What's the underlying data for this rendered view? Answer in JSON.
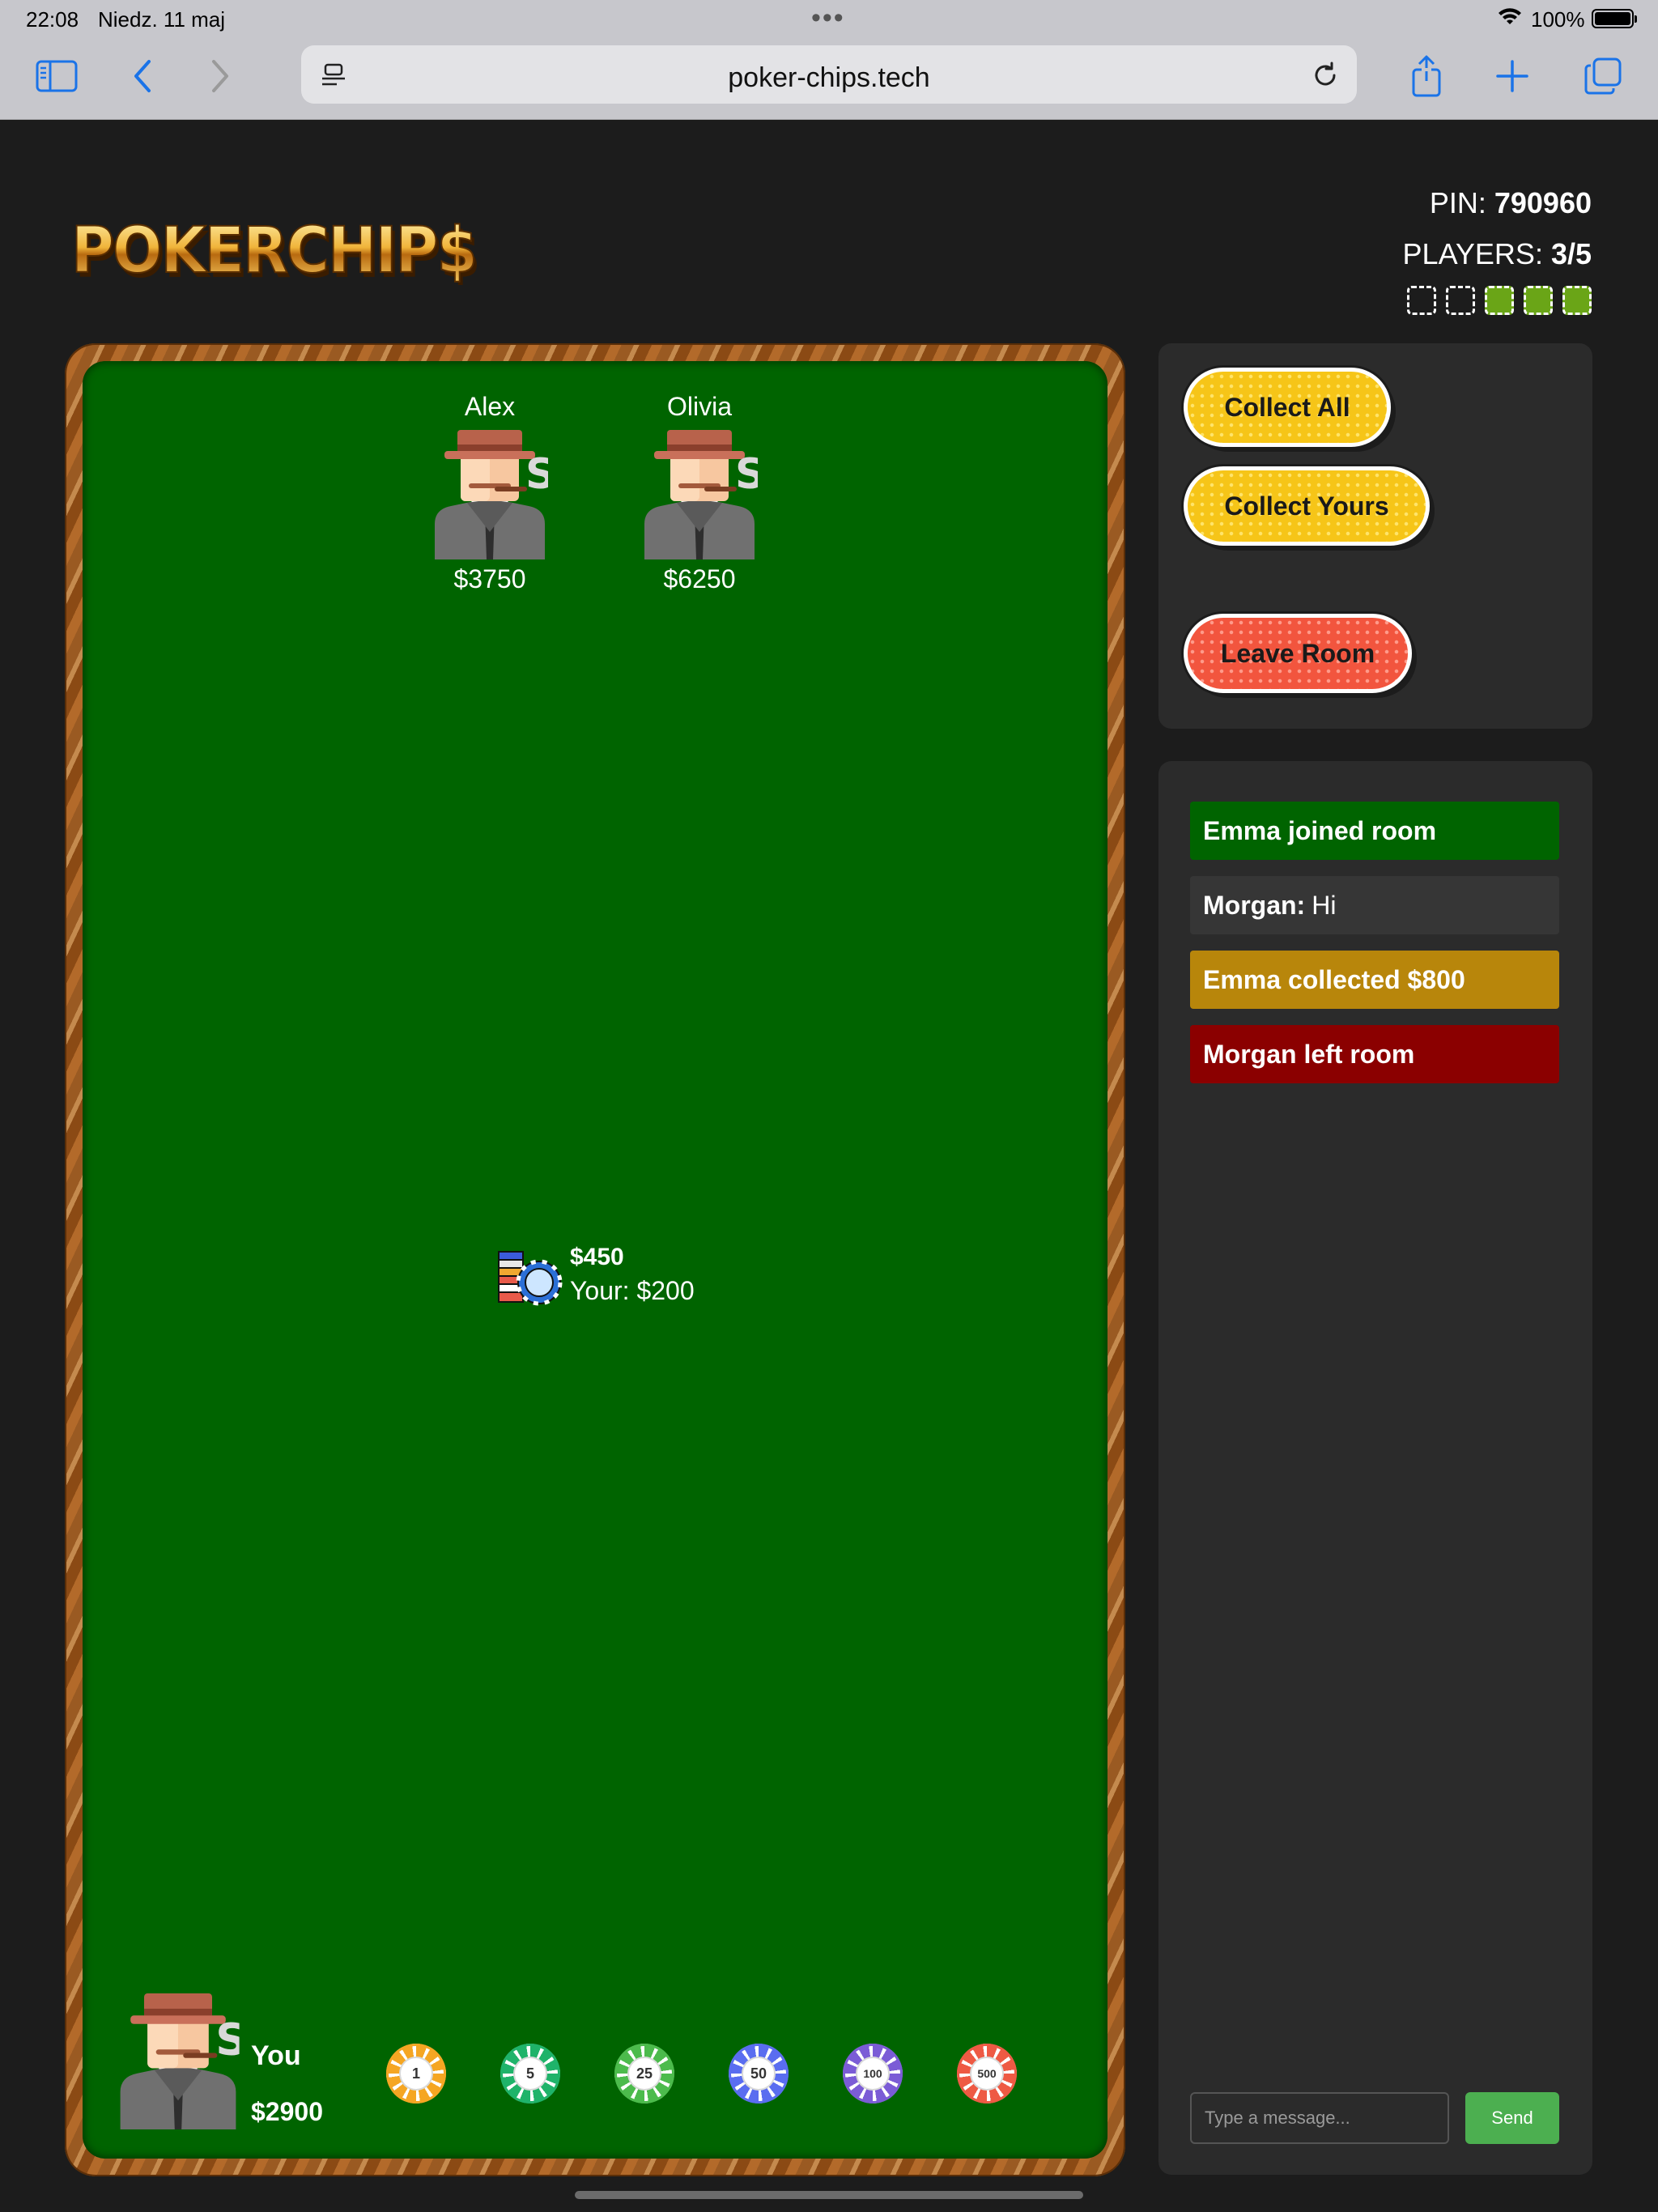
{
  "status_bar": {
    "time": "22:08",
    "date": "Niedz. 11 maj",
    "battery": "100%",
    "more_dots": "•••"
  },
  "browser": {
    "url": "poker-chips.tech"
  },
  "header": {
    "logo_text": "POKERCHIP$",
    "pin_label": "PIN: ",
    "pin_value": "790960",
    "players_label": "PLAYERS: ",
    "players_value": "3/5",
    "slots_total": 5,
    "slots_filled": 3
  },
  "table": {
    "opponents": [
      {
        "name": "Alex",
        "money": "$3750"
      },
      {
        "name": "Olivia",
        "money": "$6250"
      }
    ],
    "pot": {
      "total": "$450",
      "yours": "Your: $200"
    },
    "me": {
      "name": "You",
      "money": "$2900"
    },
    "chips": [
      {
        "value": "1",
        "color": "#f5a623"
      },
      {
        "value": "5",
        "color": "#1fb36a"
      },
      {
        "value": "25",
        "color": "#4cbb4c"
      },
      {
        "value": "50",
        "color": "#5a6df0"
      },
      {
        "value": "100",
        "color": "#7b5cd6"
      },
      {
        "value": "500",
        "color": "#ee5a44"
      }
    ]
  },
  "actions": {
    "collect_all": "Collect All",
    "collect_yours": "Collect Yours",
    "leave_room": "Leave Room"
  },
  "chat": {
    "messages": [
      {
        "text": "Emma joined room"
      },
      {
        "sender": "Morgan:",
        "text": "Hi"
      },
      {
        "text": "Emma collected $800"
      },
      {
        "text": "Morgan left room"
      }
    ],
    "input_placeholder": "Type a message...",
    "send_label": "Send"
  },
  "colors": {
    "felt": "#006400",
    "join": "#006400",
    "collect": "#b8860b",
    "leave": "#8b0000",
    "send": "#4caf50",
    "button_yellow": "#f6c518",
    "button_red": "#f2553e"
  }
}
